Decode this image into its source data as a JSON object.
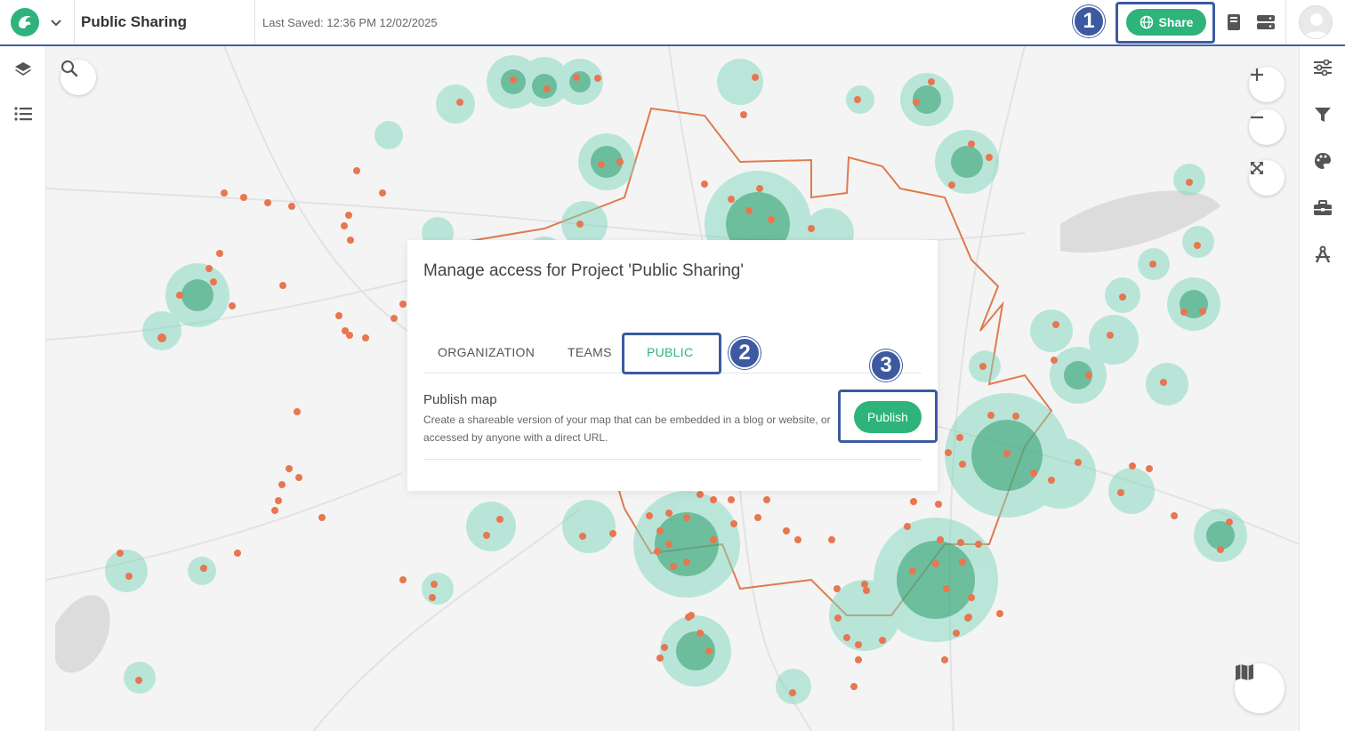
{
  "header": {
    "project_title": "Public Sharing",
    "last_saved": "Last Saved: 12:36 PM 12/02/2025",
    "share_label": "Share"
  },
  "annotations": {
    "step1": "1",
    "step2": "2",
    "step3": "3"
  },
  "modal": {
    "title": "Manage access for Project 'Public Sharing'",
    "tabs": [
      {
        "label": "ORGANIZATION"
      },
      {
        "label": "TEAMS"
      },
      {
        "label": "PUBLIC"
      }
    ],
    "publish_section": {
      "title": "Publish map",
      "description": "Create a shareable version of your map that can be embedded in a blog or website, or accessed by anyone with a direct URL.",
      "button_label": "Publish"
    }
  },
  "icons": {
    "left_sidebar": [
      "layers-icon",
      "list-icon"
    ],
    "right_sidebar": [
      "sliders-icon",
      "filter-icon",
      "palette-icon",
      "toolbox-icon",
      "compass-icon"
    ],
    "map_controls": [
      "search-icon",
      "zoom-in-icon",
      "zoom-out-icon",
      "fullscreen-icon",
      "basemap-icon"
    ],
    "topbar": [
      "logo-icon",
      "chevron-down-icon",
      "globe-icon",
      "book-icon",
      "server-icon",
      "avatar"
    ]
  },
  "colors": {
    "accent": "#2eb37a",
    "annotation": "#3d5aa0",
    "boundary": "#e07a4d",
    "point": "#e8764f"
  }
}
